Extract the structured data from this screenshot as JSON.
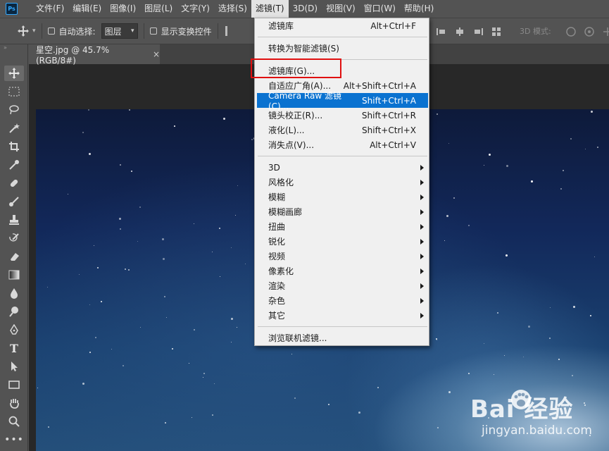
{
  "app": {
    "logo": "Ps"
  },
  "menubar": {
    "items": [
      "文件(F)",
      "编辑(E)",
      "图像(I)",
      "图层(L)",
      "文字(Y)",
      "选择(S)",
      "滤镜(T)",
      "3D(D)",
      "视图(V)",
      "窗口(W)",
      "帮助(H)"
    ],
    "active_index": 6
  },
  "options": {
    "auto_select_label": "自动选择:",
    "auto_select_value": "图层",
    "show_transform_label": "显示变换控件",
    "mode_label": "3D 模式:"
  },
  "document": {
    "tab_title": "星空.jpg @ 45.7%(RGB/8#)",
    "close_glyph": "×"
  },
  "filter_menu": {
    "items": [
      {
        "label": "滤镜库",
        "shortcut": "Alt+Ctrl+F"
      },
      {
        "label": "转换为智能滤镜(S)",
        "shortcut": ""
      },
      {
        "label": "滤镜库(G)...",
        "shortcut": ""
      },
      {
        "label": "自适应广角(A)...",
        "shortcut": "Alt+Shift+Ctrl+A"
      },
      {
        "label": "Camera Raw 滤镜(C)...",
        "shortcut": "Shift+Ctrl+A"
      },
      {
        "label": "镜头校正(R)...",
        "shortcut": "Shift+Ctrl+R"
      },
      {
        "label": "液化(L)...",
        "shortcut": "Shift+Ctrl+X"
      },
      {
        "label": "消失点(V)...",
        "shortcut": "Alt+Ctrl+V"
      },
      {
        "label": "3D",
        "submenu": true
      },
      {
        "label": "风格化",
        "submenu": true
      },
      {
        "label": "模糊",
        "submenu": true
      },
      {
        "label": "模糊画廊",
        "submenu": true
      },
      {
        "label": "扭曲",
        "submenu": true
      },
      {
        "label": "锐化",
        "submenu": true
      },
      {
        "label": "视频",
        "submenu": true
      },
      {
        "label": "像素化",
        "submenu": true
      },
      {
        "label": "渲染",
        "submenu": true
      },
      {
        "label": "杂色",
        "submenu": true
      },
      {
        "label": "其它",
        "submenu": true
      },
      {
        "label": "浏览联机滤镜...",
        "shortcut": ""
      }
    ],
    "highlighted_index": 4,
    "annotated_index": 2,
    "annotation_color": "#e01010",
    "highlight_color": "#0a72d0"
  },
  "tools": [
    "move-icon",
    "marquee-icon",
    "lasso-icon",
    "magic-wand-icon",
    "crop-icon",
    "eyedropper-icon",
    "healing-brush-icon",
    "brush-icon",
    "clone-stamp-icon",
    "history-brush-icon",
    "eraser-icon",
    "gradient-icon",
    "blur-icon",
    "dodge-icon",
    "pen-icon",
    "type-icon",
    "path-select-icon",
    "rectangle-icon",
    "hand-icon",
    "zoom-icon",
    "more-tools-icon"
  ],
  "watermark": {
    "main": "Bai 经验",
    "sub": "jingyan.baidu.com"
  }
}
